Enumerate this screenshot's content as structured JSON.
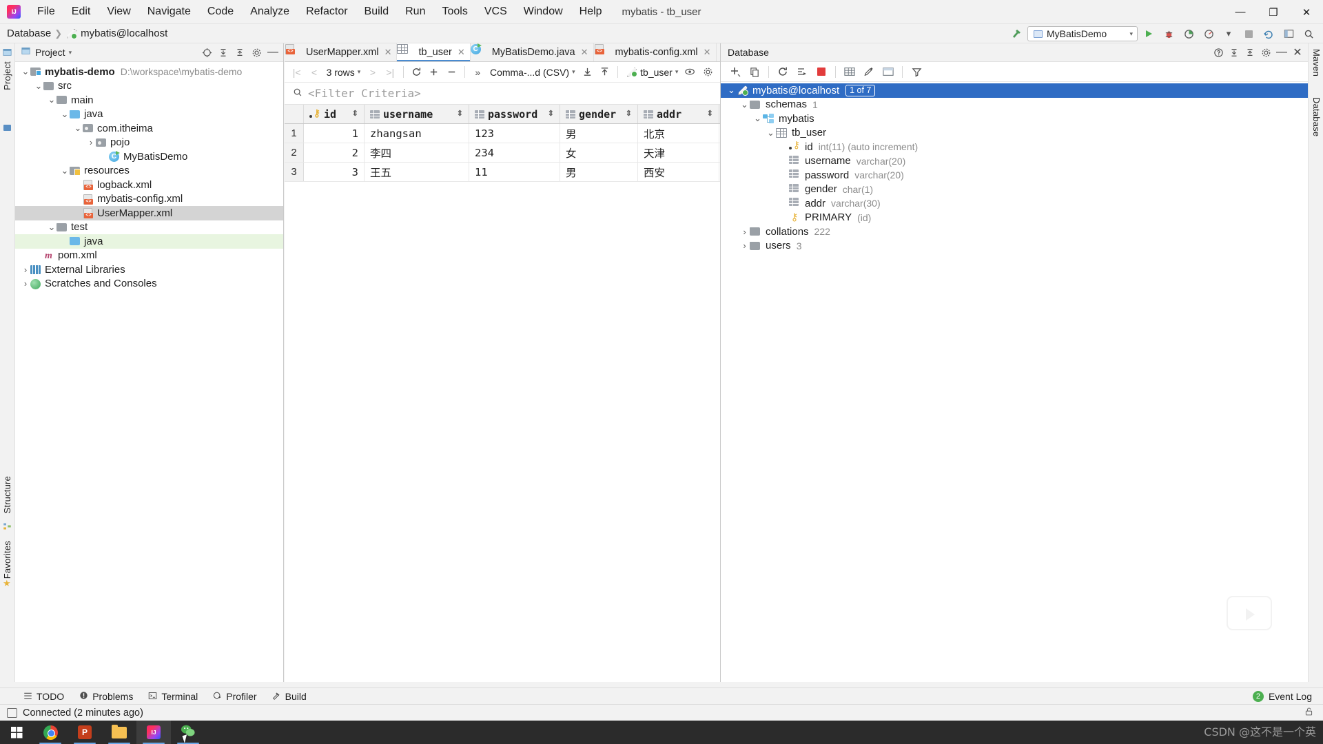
{
  "window": {
    "title": "mybatis - tb_user",
    "minimize": "—",
    "maximize": "❐",
    "close": "✕"
  },
  "menubar": [
    {
      "label": "File"
    },
    {
      "label": "Edit"
    },
    {
      "label": "View"
    },
    {
      "label": "Navigate"
    },
    {
      "label": "Code"
    },
    {
      "label": "Analyze"
    },
    {
      "label": "Refactor"
    },
    {
      "label": "Build"
    },
    {
      "label": "Run"
    },
    {
      "label": "Tools"
    },
    {
      "label": "VCS"
    },
    {
      "label": "Window"
    },
    {
      "label": "Help"
    }
  ],
  "navbar": {
    "crumbs": [
      "Database",
      "mybatis@localhost"
    ],
    "separator": "❯",
    "run_config": "MyBatisDemo",
    "icons": [
      "hammer-icon",
      "run-icon",
      "debug-icon",
      "coverage-icon",
      "profile-icon",
      "stop-icon",
      "update-icon",
      "layout-icon",
      "search-icon"
    ]
  },
  "rails": {
    "left_top": "Project",
    "left_structure": "Structure",
    "left_favorites": "Favorites",
    "right_maven": "Maven",
    "right_database": "Database"
  },
  "project_panel": {
    "title": "Project",
    "tree": [
      {
        "label": "mybatis-demo",
        "sub": "D:\\workspace\\mybatis-demo",
        "icon": "module-folder-icon",
        "depth": 0,
        "arrow": "expanded",
        "bold": true
      },
      {
        "label": "src",
        "sub": "",
        "icon": "folder-icon",
        "depth": 1,
        "arrow": "expanded",
        "bold": false
      },
      {
        "label": "main",
        "sub": "",
        "icon": "folder-icon",
        "depth": 2,
        "arrow": "expanded",
        "bold": false
      },
      {
        "label": "java",
        "sub": "",
        "icon": "source-folder-icon",
        "depth": 3,
        "arrow": "expanded",
        "bold": false
      },
      {
        "label": "com.itheima",
        "sub": "",
        "icon": "package-icon",
        "depth": 4,
        "arrow": "expanded",
        "bold": false
      },
      {
        "label": "pojo",
        "sub": "",
        "icon": "package-icon",
        "depth": 5,
        "arrow": "collapsed",
        "bold": false
      },
      {
        "label": "MyBatisDemo",
        "sub": "",
        "icon": "java-class-icon",
        "depth": 6,
        "arrow": "none",
        "bold": false
      },
      {
        "label": "resources",
        "sub": "",
        "icon": "resources-folder-icon",
        "depth": 3,
        "arrow": "expanded",
        "bold": false
      },
      {
        "label": "logback.xml",
        "sub": "",
        "icon": "xml-file-icon",
        "depth": 4,
        "arrow": "none",
        "bold": false
      },
      {
        "label": "mybatis-config.xml",
        "sub": "",
        "icon": "xml-file-icon",
        "depth": 4,
        "arrow": "none",
        "bold": false
      },
      {
        "label": "UserMapper.xml",
        "sub": "",
        "icon": "xml-file-icon",
        "depth": 4,
        "arrow": "none",
        "bold": false,
        "state": "selected"
      },
      {
        "label": "test",
        "sub": "",
        "icon": "folder-icon",
        "depth": 2,
        "arrow": "expanded",
        "bold": false
      },
      {
        "label": "java",
        "sub": "",
        "icon": "test-source-folder-icon",
        "depth": 3,
        "arrow": "none",
        "bold": false,
        "state": "highlighted"
      },
      {
        "label": "pom.xml",
        "sub": "",
        "icon": "maven-icon",
        "depth": 1,
        "arrow": "none",
        "bold": false
      },
      {
        "label": "External Libraries",
        "sub": "",
        "icon": "libraries-icon",
        "depth": 0,
        "arrow": "collapsed",
        "bold": false
      },
      {
        "label": "Scratches and Consoles",
        "sub": "",
        "icon": "scratches-icon",
        "depth": 0,
        "arrow": "collapsed",
        "bold": false
      }
    ]
  },
  "editor": {
    "tabs": [
      {
        "label": "UserMapper.xml",
        "icon": "xml-file-icon",
        "active": false
      },
      {
        "label": "tb_user",
        "icon": "db-table-icon",
        "active": true
      },
      {
        "label": "MyBatisDemo.java",
        "icon": "java-class-icon",
        "active": false
      },
      {
        "label": "mybatis-config.xml",
        "icon": "xml-file-icon",
        "active": false
      }
    ],
    "data_toolbar": {
      "row_count": "3 rows",
      "export_format": "Comma-...d (CSV)",
      "table_chip": "tb_user",
      "icons": [
        "first-page-icon",
        "prev-page-icon",
        "next-page-icon",
        "last-page-icon",
        "refresh-icon",
        "add-row-icon",
        "remove-row-icon",
        "more-icon",
        "download-icon",
        "upload-icon",
        "view-icon",
        "settings-icon"
      ]
    },
    "filter": {
      "placeholder": "<Filter Criteria>",
      "icon": "search-icon"
    }
  },
  "grid_data": {
    "columns": [
      {
        "name": "id",
        "icon": "primary-key-icon"
      },
      {
        "name": "username",
        "icon": "column-icon"
      },
      {
        "name": "password",
        "icon": "column-icon"
      },
      {
        "name": "gender",
        "icon": "column-icon"
      },
      {
        "name": "addr",
        "icon": "column-icon"
      }
    ],
    "rows": [
      {
        "n": "1",
        "id": "1",
        "username": "zhangsan",
        "password": "123",
        "gender": "男",
        "addr": "北京"
      },
      {
        "n": "2",
        "id": "2",
        "username": "李四",
        "password": "234",
        "gender": "女",
        "addr": "天津"
      },
      {
        "n": "3",
        "id": "3",
        "username": "王五",
        "password": "11",
        "gender": "男",
        "addr": "西安"
      }
    ]
  },
  "db_panel": {
    "title": "Database",
    "toolbar_icons": [
      "add-icon",
      "duplicate-icon",
      "refresh-icon",
      "jump-to-console-icon",
      "stop-icon",
      "table-editor-icon",
      "modify-icon",
      "data-icon",
      "filter-icon"
    ],
    "head_icons": [
      "help-icon",
      "expand-all-icon",
      "collapse-all-icon",
      "settings-icon",
      "hide-icon",
      "minimize-icon"
    ],
    "tree": [
      {
        "label": "mybatis@localhost",
        "sub": "",
        "badge": "1 of 7",
        "icon": "connection-icon",
        "depth": 0,
        "arrow": "expanded",
        "selected": true
      },
      {
        "label": "schemas",
        "sub": "1",
        "badge": "",
        "icon": "folder-icon",
        "depth": 1,
        "arrow": "expanded",
        "selected": false
      },
      {
        "label": "mybatis",
        "sub": "",
        "badge": "",
        "icon": "schema-icon",
        "depth": 2,
        "arrow": "expanded",
        "selected": false
      },
      {
        "label": "tb_user",
        "sub": "",
        "badge": "",
        "icon": "db-table-icon",
        "depth": 3,
        "arrow": "expanded",
        "selected": false
      },
      {
        "label": "id",
        "sub": "int(11) (auto increment)",
        "badge": "",
        "icon": "primary-key-icon",
        "depth": 4,
        "arrow": "none",
        "selected": false
      },
      {
        "label": "username",
        "sub": "varchar(20)",
        "badge": "",
        "icon": "column-icon",
        "depth": 4,
        "arrow": "none",
        "selected": false
      },
      {
        "label": "password",
        "sub": "varchar(20)",
        "badge": "",
        "icon": "column-icon",
        "depth": 4,
        "arrow": "none",
        "selected": false
      },
      {
        "label": "gender",
        "sub": "char(1)",
        "badge": "",
        "icon": "column-icon",
        "depth": 4,
        "arrow": "none",
        "selected": false
      },
      {
        "label": "addr",
        "sub": "varchar(30)",
        "badge": "",
        "icon": "column-icon",
        "depth": 4,
        "arrow": "none",
        "selected": false
      },
      {
        "label": "PRIMARY",
        "sub": "(id)",
        "badge": "",
        "icon": "key-icon",
        "depth": 4,
        "arrow": "none",
        "selected": false
      },
      {
        "label": "collations",
        "sub": "222",
        "badge": "",
        "icon": "folder-icon",
        "depth": 1,
        "arrow": "collapsed",
        "selected": false
      },
      {
        "label": "users",
        "sub": "3",
        "badge": "",
        "icon": "folder-icon",
        "depth": 1,
        "arrow": "collapsed",
        "selected": false
      }
    ]
  },
  "toolwindow_bar": {
    "items": [
      {
        "label": "TODO",
        "icon": "todo-icon"
      },
      {
        "label": "Problems",
        "icon": "problems-icon"
      },
      {
        "label": "Terminal",
        "icon": "terminal-icon"
      },
      {
        "label": "Profiler",
        "icon": "profiler-icon"
      },
      {
        "label": "Build",
        "icon": "build-icon"
      }
    ],
    "event_log": "Event Log",
    "event_count": "2"
  },
  "statusbar": {
    "message": "Connected (2 minutes ago)",
    "lock_icon": "unlocked-icon"
  },
  "taskbar": {
    "apps": [
      {
        "name": "start-button",
        "icon": "windows-logo-icon"
      },
      {
        "name": "chrome",
        "icon": "chrome-icon"
      },
      {
        "name": "powerpoint",
        "icon": "powerpoint-icon",
        "label": "P"
      },
      {
        "name": "file-explorer",
        "icon": "folder-icon"
      },
      {
        "name": "intellij-idea",
        "icon": "intellij-icon",
        "label": "IJ"
      },
      {
        "name": "wechat",
        "icon": "wechat-icon"
      }
    ]
  },
  "watermark": "CSDN @这不是一个英"
}
